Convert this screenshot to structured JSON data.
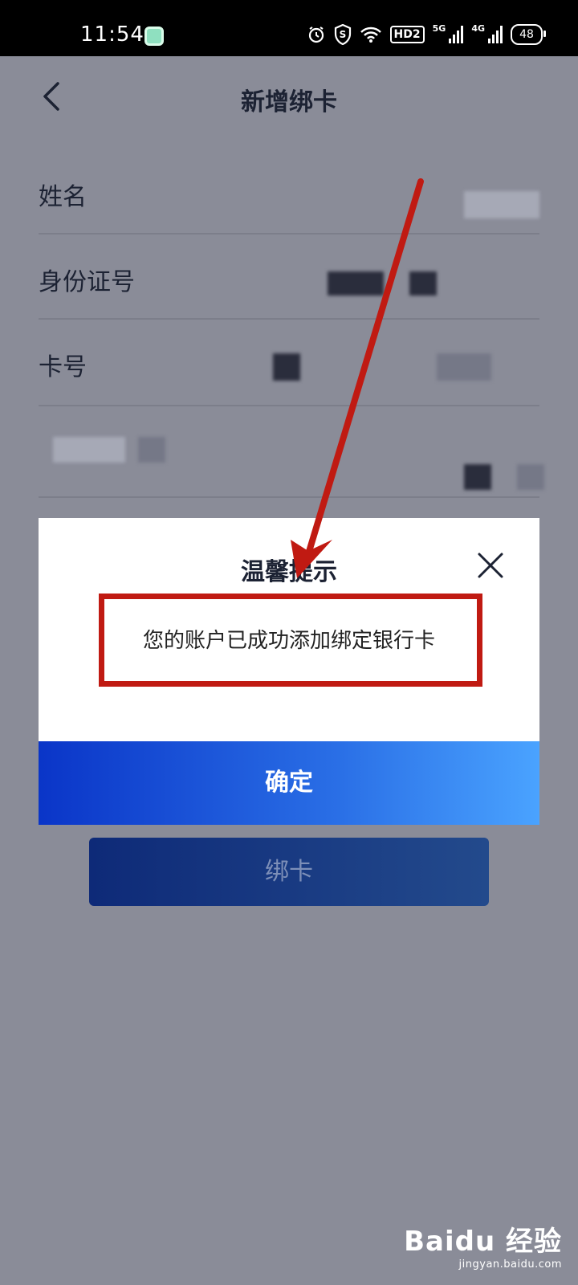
{
  "status_bar": {
    "time": "11:54",
    "hd_label": "HD2",
    "net1_label": "5G",
    "net2_label": "4G",
    "battery": "48"
  },
  "header": {
    "title": "新增绑卡"
  },
  "form": {
    "name_label": "姓名",
    "id_label": "身份证号",
    "card_label": "卡号"
  },
  "bind_button": {
    "label": "绑卡"
  },
  "dialog": {
    "title": "温馨提示",
    "message": "您的账户已成功添加绑定银行卡",
    "confirm_label": "确定"
  },
  "watermark": {
    "logo": "Baidu 经验",
    "url": "jingyan.baidu.com"
  },
  "colors": {
    "accent": "#1c4fe0",
    "annotation": "#c01a12",
    "overlay": "#8a8c98"
  }
}
